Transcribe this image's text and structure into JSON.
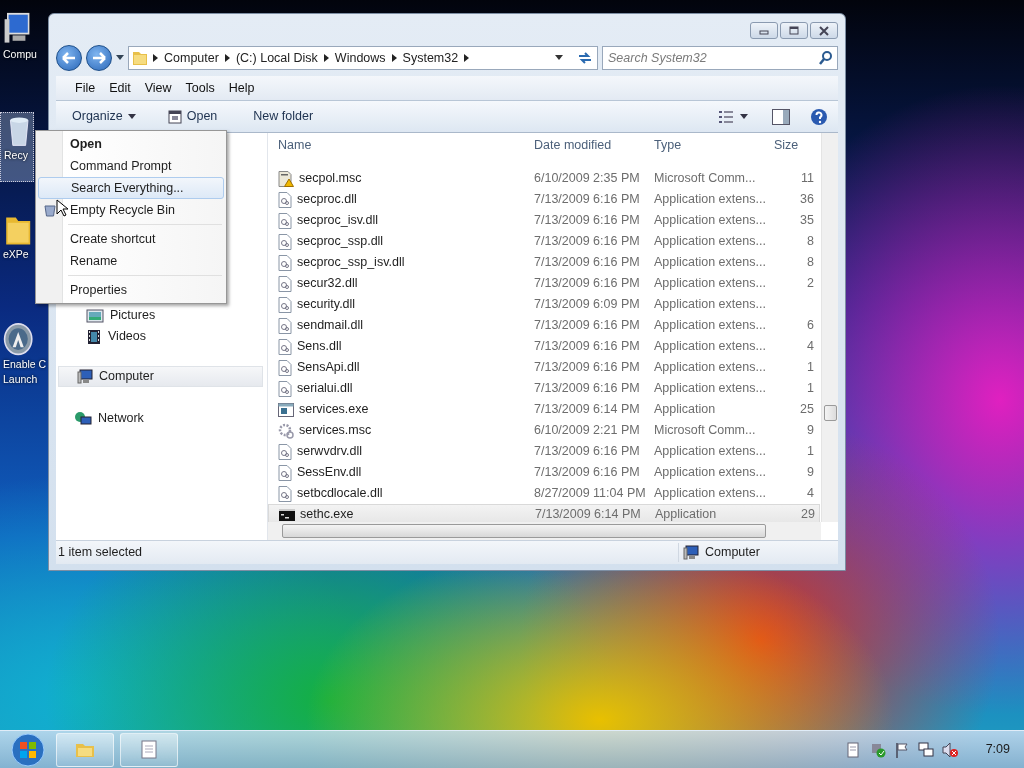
{
  "desktop_icons": [
    {
      "kind": "computer",
      "lines": [
        "Compu"
      ],
      "selected": false
    },
    {
      "kind": "recycle",
      "lines": [
        "Recy"
      ],
      "selected": true
    },
    {
      "kind": "folder",
      "lines": [
        "eXPe"
      ],
      "selected": false
    },
    {
      "kind": "launcher",
      "lines": [
        "Enable C",
        "Launch"
      ],
      "selected": false
    }
  ],
  "window": {
    "breadcrumb": [
      "Computer",
      "(C:) Local Disk",
      "Windows",
      "System32"
    ],
    "search": {
      "placeholder": "Search System32"
    },
    "menu": [
      "File",
      "Edit",
      "View",
      "Tools",
      "Help"
    ],
    "toolbar": [
      "Organize",
      "Open",
      "New folder"
    ],
    "sidebar": [
      {
        "children": [
          {
            "label": "Pictures",
            "kind": "pictures",
            "selected": false
          },
          {
            "label": "Videos",
            "kind": "videos",
            "selected": false
          }
        ]
      },
      {
        "label": "Computer",
        "kind": "computer",
        "selected": true
      },
      {
        "label": "Network",
        "kind": "network",
        "selected": false
      }
    ],
    "table": {
      "columns": [
        "Name",
        "Date modified",
        "Type",
        "Size"
      ],
      "rows": [
        {
          "kind": "msc",
          "name": "secpol.msc",
          "date": "6/10/2009 2:35 PM",
          "type": "Microsoft Comm...",
          "size": "11",
          "selected": false
        },
        {
          "kind": "dll",
          "name": "secproc.dll",
          "date": "7/13/2009 6:16 PM",
          "type": "Application extens...",
          "size": "36",
          "selected": false
        },
        {
          "kind": "dll",
          "name": "secproc_isv.dll",
          "date": "7/13/2009 6:16 PM",
          "type": "Application extens...",
          "size": "35",
          "selected": false
        },
        {
          "kind": "dll",
          "name": "secproc_ssp.dll",
          "date": "7/13/2009 6:16 PM",
          "type": "Application extens...",
          "size": "8",
          "selected": false
        },
        {
          "kind": "dll",
          "name": "secproc_ssp_isv.dll",
          "date": "7/13/2009 6:16 PM",
          "type": "Application extens...",
          "size": "8",
          "selected": false
        },
        {
          "kind": "dll",
          "name": "secur32.dll",
          "date": "7/13/2009 6:16 PM",
          "type": "Application extens...",
          "size": "2",
          "selected": false
        },
        {
          "kind": "dll",
          "name": "security.dll",
          "date": "7/13/2009 6:09 PM",
          "type": "Application extens...",
          "selected": false
        },
        {
          "kind": "dll",
          "name": "sendmail.dll",
          "date": "7/13/2009 6:16 PM",
          "type": "Application extens...",
          "size": "6",
          "selected": false
        },
        {
          "kind": "dll",
          "name": "Sens.dll",
          "date": "7/13/2009 6:16 PM",
          "type": "Application extens...",
          "size": "4",
          "selected": false
        },
        {
          "kind": "dll",
          "name": "SensApi.dll",
          "date": "7/13/2009 6:16 PM",
          "type": "Application extens...",
          "size": "1",
          "selected": false
        },
        {
          "kind": "dll",
          "name": "serialui.dll",
          "date": "7/13/2009 6:16 PM",
          "type": "Application extens...",
          "size": "1",
          "selected": false
        },
        {
          "kind": "exe",
          "name": "services.exe",
          "date": "7/13/2009 6:14 PM",
          "type": "Application",
          "size": "25",
          "selected": false
        },
        {
          "kind": "gear",
          "name": "services.msc",
          "date": "6/10/2009 2:21 PM",
          "type": "Microsoft Comm...",
          "size": "9",
          "selected": false
        },
        {
          "kind": "dll",
          "name": "serwvdrv.dll",
          "date": "7/13/2009 6:16 PM",
          "type": "Application extens...",
          "size": "1",
          "selected": false
        },
        {
          "kind": "dll",
          "name": "SessEnv.dll",
          "date": "7/13/2009 6:16 PM",
          "type": "Application extens...",
          "size": "9",
          "selected": false
        },
        {
          "kind": "dll",
          "name": "setbcdlocale.dll",
          "date": "8/27/2009 11:04 PM",
          "type": "Application extens...",
          "size": "4",
          "selected": false
        },
        {
          "kind": "console",
          "name": "sethc.exe",
          "date": "7/13/2009 6:14 PM",
          "type": "Application",
          "size": "29",
          "selected": true
        }
      ]
    },
    "status_bar": {
      "text": "1 item selected",
      "location": "Computer"
    }
  },
  "context_menu": [
    {
      "kind": "item",
      "label": "Open",
      "default": true,
      "selected": false
    },
    {
      "kind": "item",
      "label": "Command Prompt",
      "default": false,
      "selected": false
    },
    {
      "kind": "item",
      "label": "Search Everything...",
      "default": false,
      "selected": true
    },
    {
      "kind": "item",
      "label": "Empty Recycle Bin",
      "default": false,
      "selected": false,
      "icon": true
    },
    {
      "kind": "separator"
    },
    {
      "kind": "item",
      "label": "Create shortcut",
      "default": false,
      "selected": false
    },
    {
      "kind": "item",
      "label": "Rename",
      "default": false,
      "selected": false
    },
    {
      "kind": "separator"
    },
    {
      "kind": "item",
      "label": "Properties",
      "default": false,
      "selected": false
    }
  ],
  "taskbar": {
    "clock": "7:09"
  }
}
